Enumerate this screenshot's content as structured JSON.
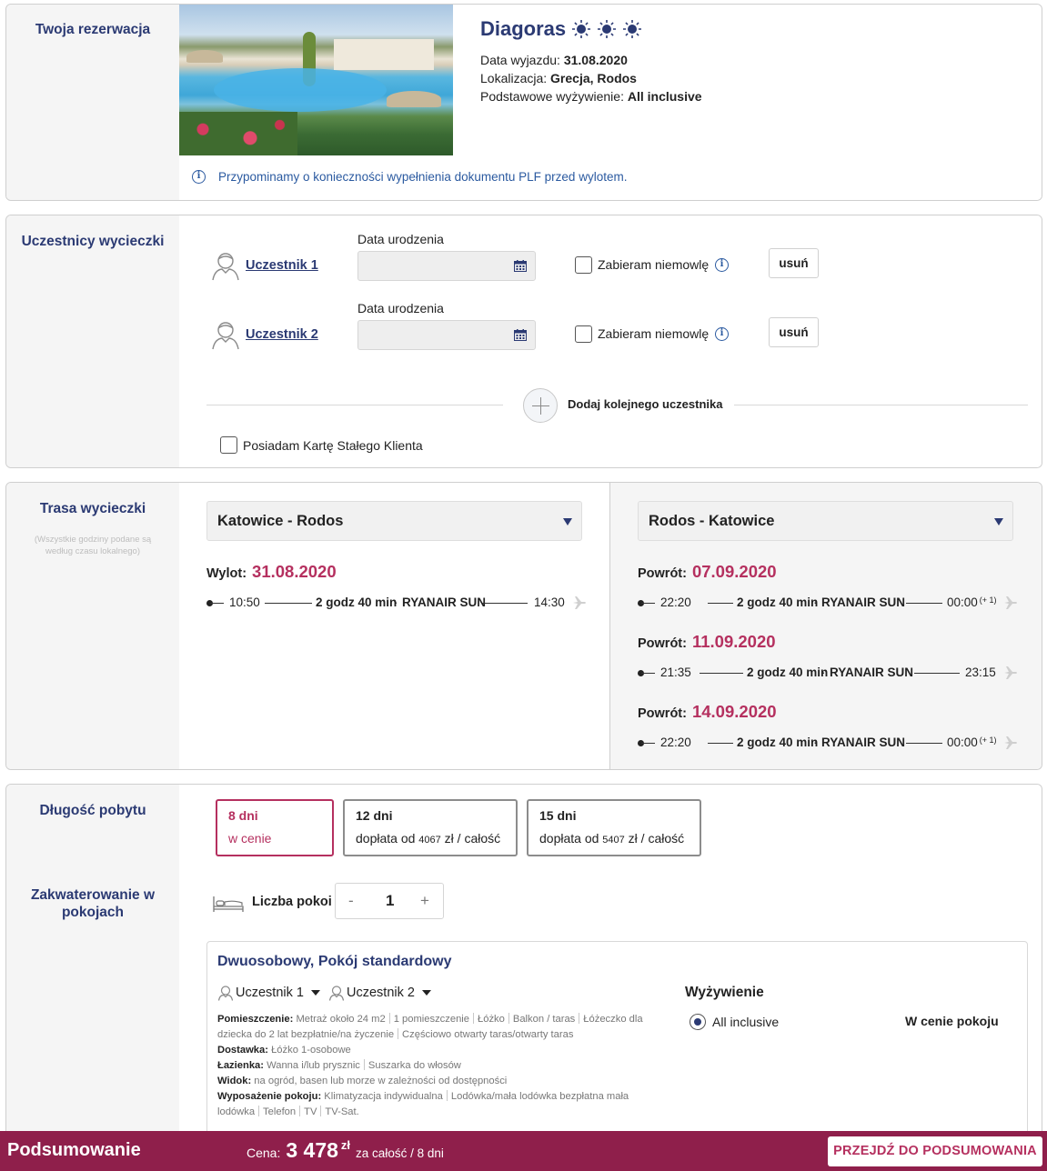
{
  "reservation": {
    "side_title": "Twoja rezerwacja",
    "hotel_name": "Diagoras",
    "departure_label": "Data wyjazdu:",
    "departure_value": "31.08.2020",
    "location_label": "Lokalizacja:",
    "location_value": "Grecja, Rodos",
    "meal_label": "Podstawowe wyżywienie:",
    "meal_value": "All inclusive",
    "plf_notice": "Przypominamy o konieczności wypełnienia dokumentu PLF przed wylotem.",
    "suns": 3
  },
  "participants": {
    "side_title": "Uczestnicy wycieczki",
    "items": [
      {
        "name": "Uczestnik 1",
        "dob_label": "Data urodzenia",
        "dob_value": "",
        "infant_label": "Zabieram niemowlę",
        "remove_label": "usuń"
      },
      {
        "name": "Uczestnik 2",
        "dob_label": "Data urodzenia",
        "dob_value": "",
        "infant_label": "Zabieram niemowlę",
        "remove_label": "usuń"
      }
    ],
    "add_label": "Dodaj kolejnego uczestnika",
    "loyalty_label": "Posiadam Kartę Stałego Klienta"
  },
  "route": {
    "side_title": "Trasa wycieczki",
    "tz_note": "(Wszystkie godziny podane są według czasu lokalnego)",
    "outbound": {
      "select": "Katowice - Rodos",
      "date_label": "Wylot:",
      "date": "31.08.2020",
      "dep": "10:50",
      "duration": "2 godz 40 min",
      "carrier": "RYANAIR SUN",
      "arr": "14:30"
    },
    "return": {
      "select": "Rodos - Katowice",
      "flights": [
        {
          "date_label": "Powrót:",
          "date": "07.09.2020",
          "dep": "22:20",
          "duration": "2 godz 40 min",
          "carrier": "RYANAIR SUN",
          "arr": "00:00",
          "next_day": "(+ 1)"
        },
        {
          "date_label": "Powrót:",
          "date": "11.09.2020",
          "dep": "21:35",
          "duration": "2 godz 40 min",
          "carrier": "RYANAIR SUN",
          "arr": "23:15",
          "next_day": ""
        },
        {
          "date_label": "Powrót:",
          "date": "14.09.2020",
          "dep": "22:20",
          "duration": "2 godz 40 min",
          "carrier": "RYANAIR SUN",
          "arr": "00:00",
          "next_day": "(+ 1)"
        }
      ]
    }
  },
  "stay": {
    "side_title": "Długość pobytu",
    "options": [
      {
        "days": "8 dni",
        "price_prefix": "w cenie",
        "amount": "",
        "suffix": "",
        "selected": true
      },
      {
        "days": "12 dni",
        "price_prefix": "dopłata od",
        "amount": "4067",
        "suffix": "zł / całość",
        "selected": false
      },
      {
        "days": "15 dni",
        "price_prefix": "dopłata od",
        "amount": "5407",
        "suffix": "zł / całość",
        "selected": false
      }
    ]
  },
  "accommodation": {
    "side_title": "Zakwaterowanie w pokojach",
    "rooms_label": "Liczba pokoi",
    "minus": "-",
    "rooms_value": "1",
    "plus": "+",
    "room": {
      "title": "Dwuosobowy, Pokój standardowy",
      "occupant_1": "Uczestnik 1",
      "occupant_2": "Uczestnik 2",
      "details": [
        {
          "label": "Pomieszczenie:",
          "values": [
            "Metraż około 24 m2",
            "1 pomieszczenie",
            "Łóżko",
            "Balkon / taras",
            "Łóżeczko dla dziecka do 2 lat bezpłatnie/na życzenie",
            "Częściowo otwarty taras/otwarty taras"
          ]
        },
        {
          "label": "Dostawka:",
          "values": [
            "Łóżko 1-osobowe"
          ]
        },
        {
          "label": "Łazienka:",
          "values": [
            "Wanna i/lub prysznic",
            "Suszarka do włosów"
          ]
        },
        {
          "label": "Widok:",
          "values": [
            "na ogród, basen lub morze w zależności od dostępności"
          ]
        },
        {
          "label": "Wyposażenie pokoju:",
          "values": [
            "Klimatyzacja indywidualna",
            "Lodówka/mała lodówka bezpłatna mała lodówka",
            "Telefon",
            "TV",
            "TV-Sat."
          ]
        }
      ],
      "meal_title": "Wyżywienie",
      "meal_option": "All inclusive",
      "meal_price": "W cenie pokoju"
    }
  },
  "footer": {
    "title": "Podsumowanie",
    "price_label": "Cena:",
    "price_value": "3 478",
    "currency": "zł",
    "price_suffix": "za całość / 8 dni",
    "cta": "PRZEJDŹ DO PODSUMOWANIA"
  },
  "colors": {
    "navy": "#2b3a73",
    "crimson": "#b5305f",
    "footer_bg": "#8f1f4b",
    "info_blue": "#2b5aa0"
  }
}
